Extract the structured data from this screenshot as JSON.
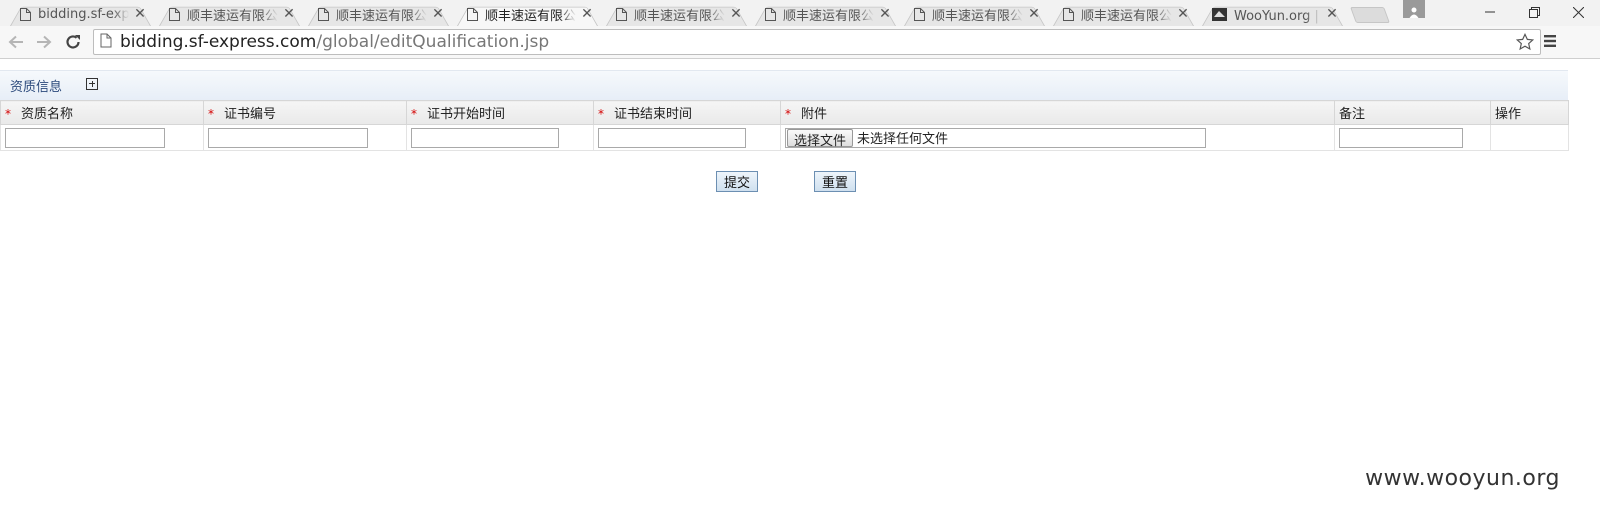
{
  "browser": {
    "tabs": [
      {
        "title": "bidding.sf-expre",
        "favicon": "page-icon",
        "active": false
      },
      {
        "title": "顺丰速运有限公司",
        "favicon": "page-icon",
        "active": false
      },
      {
        "title": "顺丰速运有限公司",
        "favicon": "page-icon",
        "active": false
      },
      {
        "title": "顺丰速运有限公司",
        "favicon": "page-icon",
        "active": true
      },
      {
        "title": "顺丰速运有限公司",
        "favicon": "page-icon",
        "active": false
      },
      {
        "title": "顺丰速运有限公司",
        "favicon": "page-icon",
        "active": false
      },
      {
        "title": "顺丰速运有限公司",
        "favicon": "page-icon",
        "active": false
      },
      {
        "title": "顺丰速运有限公司",
        "favicon": "page-icon",
        "active": false
      },
      {
        "title": "WooYun.org | 自",
        "favicon": "wooyun-logo-icon",
        "active": false
      }
    ],
    "close_glyph": "✕",
    "url_host": "bidding.sf-express.com",
    "url_path": "/global/editQualification.jsp"
  },
  "page": {
    "section_title": "资质信息",
    "required_mark": "*",
    "columns": [
      "资质名称",
      "证书编号",
      "证书开始时间",
      "证书结束时间",
      "附件",
      "备注",
      "操作"
    ],
    "file_button_label": "选择文件",
    "file_status": "未选择任何文件",
    "submit_label": "提交",
    "reset_label": "重置"
  },
  "watermark": "www.wooyun.org"
}
